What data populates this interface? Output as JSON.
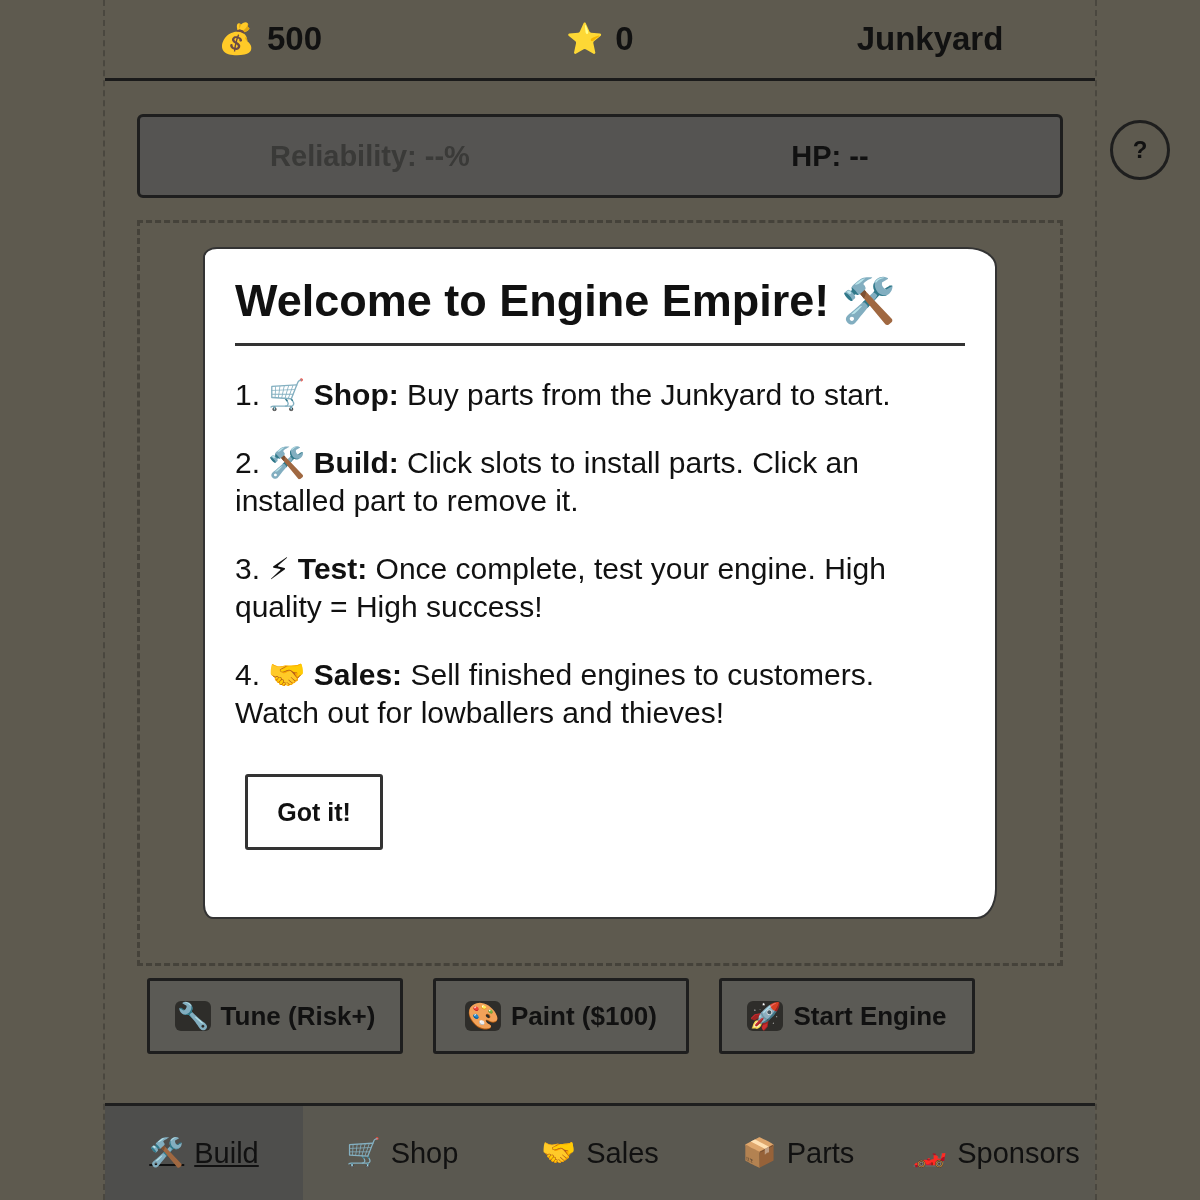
{
  "stats": [
    {
      "icon": "💰",
      "value": "500"
    },
    {
      "icon": "⭐",
      "value": "0"
    }
  ],
  "location": "Junkyard",
  "readout": {
    "reliability": "Reliability: --%",
    "reliability_disabled": true,
    "hp": "HP: --"
  },
  "help_button": "?",
  "modal": {
    "title": "Welcome to Engine Empire!",
    "title_icon": "🛠️",
    "steps": [
      {
        "number": "1.",
        "icon": "🛒",
        "text": "**Shop:** Buy parts from the Junkyard to start."
      },
      {
        "number": "2.",
        "icon": "🛠️",
        "text": "**Build:** Click slots to install parts. Click an installed part to remove it."
      },
      {
        "number": "3.",
        "icon": "⚡",
        "text": "**Test:** Once complete, test your engine. High quality = High success!"
      },
      {
        "number": "4.",
        "icon": "🤝",
        "text": "**Sales:** Sell finished engines to customers. Watch out for lowballers and thieves!"
      }
    ],
    "button": "Got it!"
  },
  "actions": [
    {
      "icon": "🔧",
      "label": "Tune (Risk+)"
    },
    {
      "icon": "🎨",
      "label": "Paint ($100)"
    },
    {
      "icon": "🚀",
      "label": "Start Engine"
    }
  ],
  "tabs": [
    {
      "icon": "🛠️",
      "label": "Build",
      "selected": true
    },
    {
      "icon": "🛒",
      "label": "Shop",
      "selected": false
    },
    {
      "icon": "🤝",
      "label": "Sales",
      "selected": false
    },
    {
      "icon": "📦",
      "label": "Parts",
      "selected": false
    },
    {
      "icon": "🏎️",
      "label": "Sponsors",
      "selected": false
    }
  ]
}
